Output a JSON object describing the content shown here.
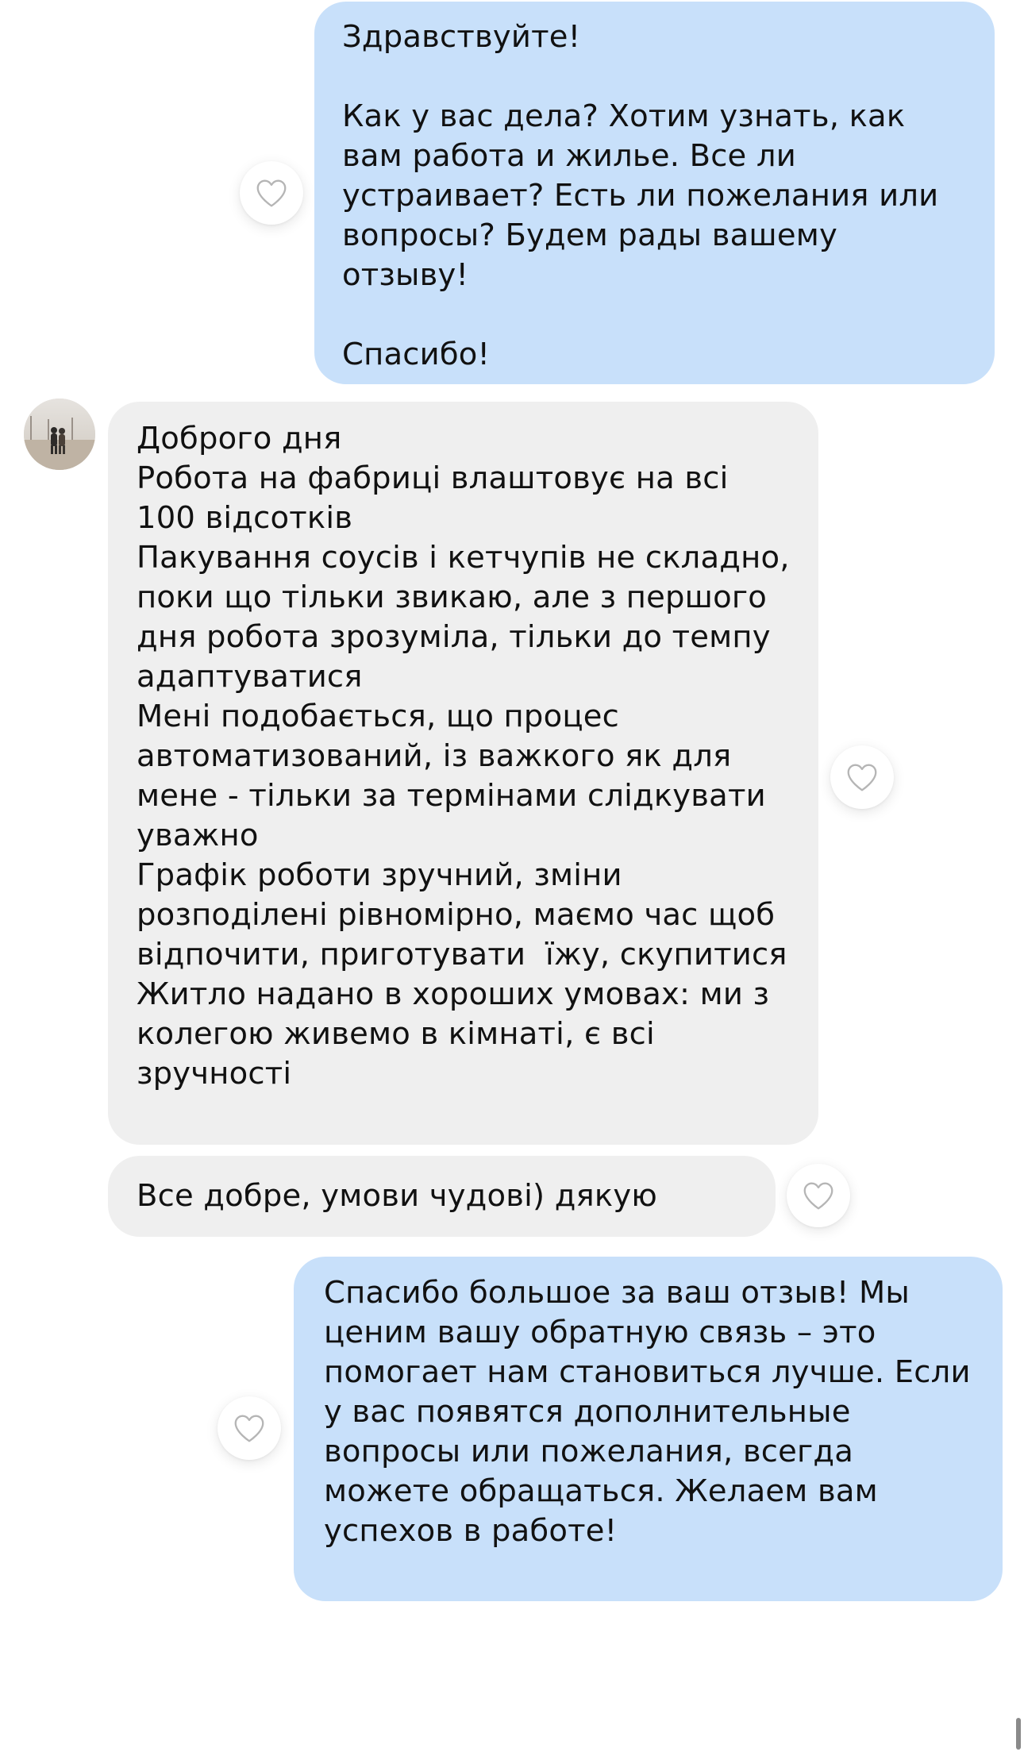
{
  "messages": [
    {
      "direction": "outgoing",
      "text": "Здравствуйте!\n\nКак у вас дела? Хотим узнать, как вам работа и жилье. Все ли устраивает? Есть ли пожелания или вопросы? Будем рады вашему отзыву!\n\nСпасибо!"
    },
    {
      "direction": "incoming",
      "text": "Доброго дня\nРобота на фабриці влаштовує на всі 100 відсотків\nПакування соусів і кетчупів не складно, поки що тільки звикаю, але з першого дня робота зрозуміла, тільки до темпу адаптуватися\nМені подобається, що процес автоматизований, із важкого як для мене - тільки за термінами слідкувати уважно\nГрафік роботи зручний, зміни розподілені рівномірно, маємо час щоб відпочити, приготувати  їжу, скупитися\nЖитло надано в хороших умовах: ми з колегою живемо в кімнаті, є всі зручності"
    },
    {
      "direction": "incoming",
      "text": "Все добре, умови чудові) дякую"
    },
    {
      "direction": "outgoing",
      "text": "Спасибо большое за ваш отзыв! Мы ценим вашу обратную связь – это помогает нам становиться лучше. Если у вас появятся дополнительные вопросы или пожелания, всегда можете обращаться. Желаем вам успехов в работе!"
    }
  ],
  "icons": {
    "like": "heart-outline-icon",
    "avatar": "user-avatar"
  },
  "colors": {
    "outgoing_bubble": "#c8e0fa",
    "incoming_bubble": "#efefef",
    "heart_stroke": "#b5b5b5",
    "background": "#ffffff"
  }
}
